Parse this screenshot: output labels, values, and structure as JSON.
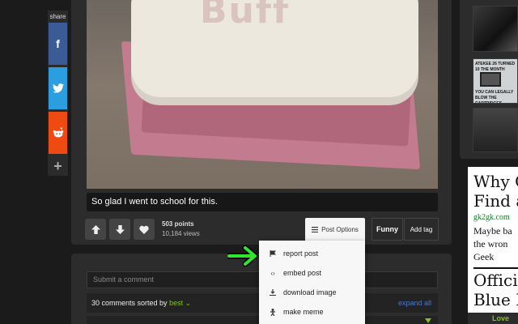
{
  "share": {
    "label": "share",
    "facebook": "f",
    "plus": "+"
  },
  "image": {
    "cake_text": "Buff"
  },
  "post": {
    "caption": "So glad I went to school for this.",
    "points": "503 points",
    "views": "10,184 views",
    "post_options_label": "Post Options",
    "funny_label": "Funny",
    "add_tag_label": "Add tag"
  },
  "dropdown": {
    "items": [
      {
        "label": "report post",
        "icon": "flag-icon"
      },
      {
        "label": "embed post",
        "icon": "code-icon"
      },
      {
        "label": "download image",
        "icon": "download-icon"
      },
      {
        "label": "make meme",
        "icon": "meme-icon"
      }
    ]
  },
  "comments": {
    "input_placeholder": "Submit a comment",
    "count_text": "30 comments sorted by",
    "sort_value": "best",
    "expand_all": "expand all"
  },
  "sidebar": {
    "thumb2_top": "ATEKEE 26 TURNED 10 THE MONTH",
    "thumb2_bottom": "YOU CAN LEGALLY BLOW THE CARTRIDGES",
    "ad_line1": "Why C",
    "ad_line2": "Find a",
    "ad_url": "gk2gk.com",
    "ad_body1": "Maybe ba",
    "ad_body2": "the wron",
    "ad_body3": "Geek",
    "ad_line3": "Officia",
    "ad_line4": "Blue B",
    "love": "Love"
  },
  "colors": {
    "accent_green": "#85bf25",
    "link_blue": "#4e76c9",
    "facebook": "#3b5b97",
    "twitter": "#2b9ee0",
    "reddit": "#ee4b12"
  }
}
